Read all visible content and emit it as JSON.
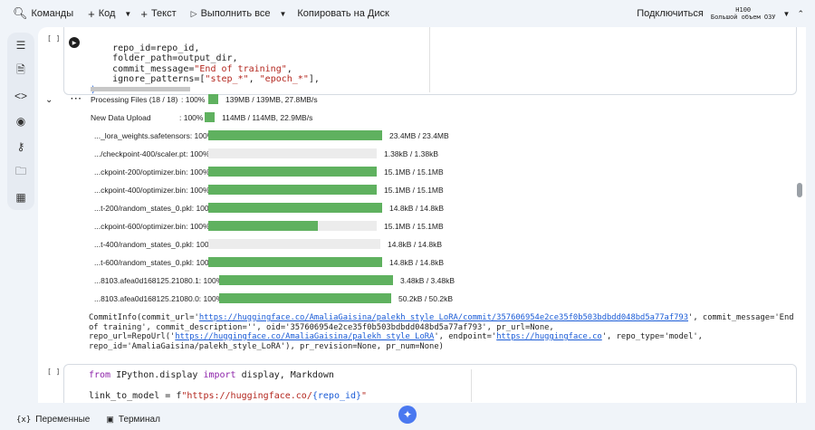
{
  "toolbar": {
    "commands": "Команды",
    "code": "Код",
    "text": "Текст",
    "run_all": "Выполнить все",
    "copy_drive": "Копировать на Диск",
    "connect": "Подключиться",
    "ram_line1": "H100",
    "ram_line2": "Большой объем ОЗУ"
  },
  "cell1": {
    "bracket": "[ ]",
    "lines": {
      "l1": "    repo_id=repo_id,",
      "l2": "    folder_path=output_dir,",
      "l3a": "    commit_message=",
      "l3b": "\"End of training\"",
      "l3c": ",",
      "l4a": "    ignore_patterns=[",
      "l4b": "\"step_*\"",
      "l4c": ", ",
      "l4d": "\"epoch_*\"",
      "l4e": "],",
      "l5": ")"
    }
  },
  "progress": [
    {
      "label": "Processing Files (18 / 18)",
      "pct": ": 100%",
      "fill": 1.0,
      "size": "139MB /  139MB, 27.8MB/s"
    },
    {
      "label": "New Data Upload",
      "pct": ": 100%",
      "fill": 1.0,
      "size": "114MB /  114MB, 22.9MB/s"
    },
    {
      "label": "..._lora_weights.safetensors: 100%",
      "pct": "",
      "fill": 1.0,
      "size": "23.4MB / 23.4MB"
    },
    {
      "label": ".../checkpoint-400/scaler.pt: 100%",
      "pct": "",
      "fill": 0.0,
      "size": "1.38kB / 1.38kB"
    },
    {
      "label": "...ckpoint-200/optimizer.bin: 100%",
      "pct": "",
      "fill": 1.0,
      "size": "15.1MB / 15.1MB"
    },
    {
      "label": "...ckpoint-400/optimizer.bin: 100%",
      "pct": "",
      "fill": 1.0,
      "size": "15.1MB / 15.1MB"
    },
    {
      "label": "...t-200/random_states_0.pkl: 100%",
      "pct": "",
      "fill": 1.0,
      "size": "14.8kB / 14.8kB"
    },
    {
      "label": "...ckpoint-600/optimizer.bin: 100%",
      "pct": "",
      "fill": 0.65,
      "size": "15.1MB / 15.1MB"
    },
    {
      "label": "...t-400/random_states_0.pkl: 100%",
      "pct": "",
      "fill": 0.0,
      "size": "14.8kB / 14.8kB"
    },
    {
      "label": "...t-600/random_states_0.pkl: 100%",
      "pct": "",
      "fill": 1.0,
      "size": "14.8kB / 14.8kB"
    },
    {
      "label": "...8103.afea0d168125.21080.1: 100%",
      "pct": "",
      "fill": 1.0,
      "size": "3.48kB / 3.48kB"
    },
    {
      "label": "...8103.afea0d168125.21080.0: 100%",
      "pct": "",
      "fill": 1.0,
      "size": "50.2kB / 50.2kB"
    }
  ],
  "output": {
    "l1a": "CommitInfo(commit_url='",
    "l1link": "https://huggingface.co/AmaliaGaisina/palekh_style_LoRA/commit/357606954e2ce35f0b503bdbdd048bd5a77af793",
    "l1b": "', commit_message='End",
    "l2": "of training', commit_description='', oid='357606954e2ce35f0b503bdbdd048bd5a77af793', pr_url=None,",
    "l3a": "repo_url=RepoUrl('",
    "l3link": "https://huggingface.co/AmaliaGaisina/palekh_style_LoRA",
    "l3b": "', endpoint='",
    "l3link2": "https://huggingface.co",
    "l3c": "', repo_type='model',",
    "l4": "repo_id='AmaliaGaisina/palekh_style_LoRA'), pr_revision=None, pr_num=None)"
  },
  "cell2": {
    "bracket": "[ ]",
    "l1kw1": "from",
    "l1a": " IPython.display ",
    "l1kw2": "import",
    "l1b": " display, Markdown",
    "l2a": "link_to_model = f",
    "l2b": "\"https://huggingface.co/",
    "l2c": "{repo_id}",
    "l2d": "\""
  },
  "bottom": {
    "variables": "Переменные",
    "terminal": "Терминал"
  }
}
